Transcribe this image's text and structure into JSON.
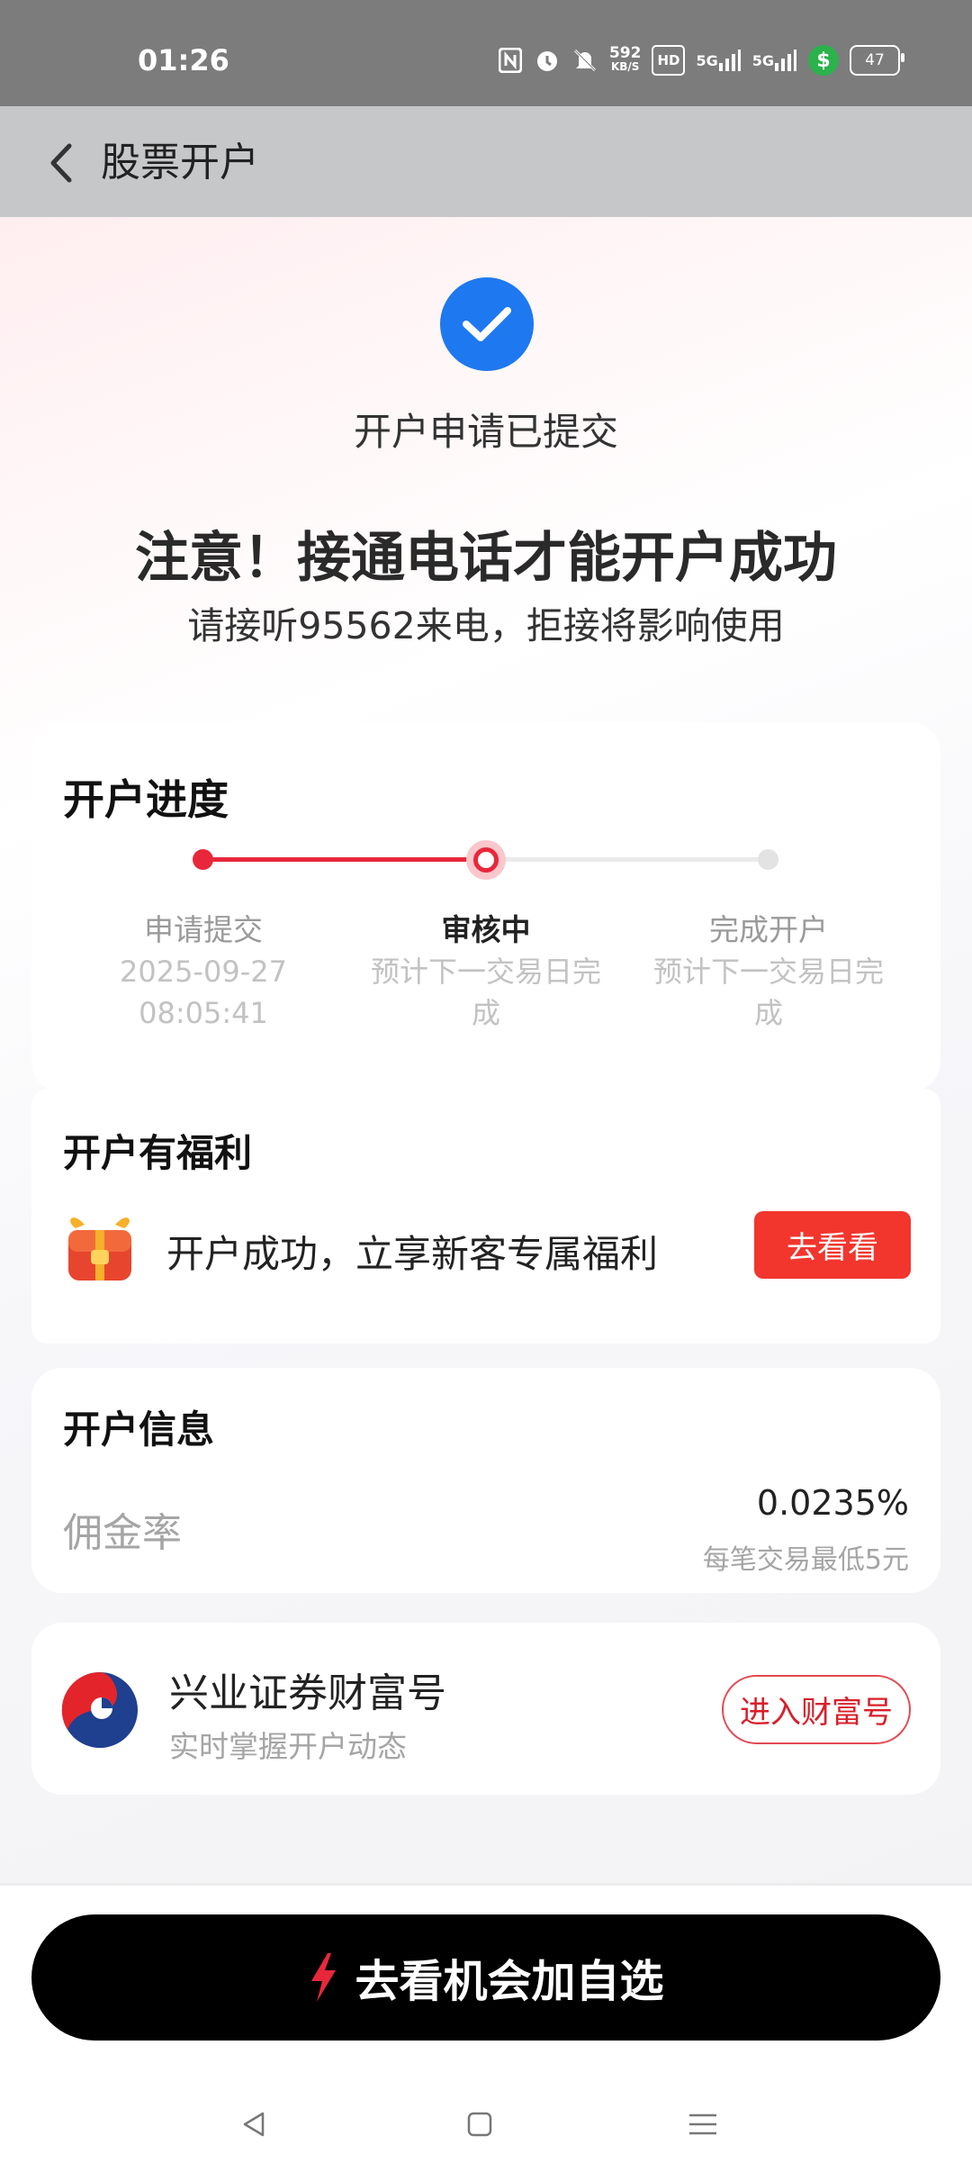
{
  "status_bar": {
    "time": "01:26",
    "icons": [
      "nfc-icon",
      "alarm-icon",
      "mute-icon",
      "network-speed",
      "hd-icon",
      "signal-5g-icon",
      "signal-5g-icon",
      "wallet-dollar-icon",
      "battery-icon"
    ],
    "network_speed_value": "592",
    "network_speed_unit": "KB/S",
    "hd_label": "HD",
    "signal_label": "5G",
    "battery_level": "47"
  },
  "header": {
    "title": "股票开户",
    "back_icon": "chevron-left-icon"
  },
  "submission": {
    "status_text": "开户申请已提交",
    "notice_title": "注意！接通电话才能开户成功",
    "notice_subtitle": "请接听95562来电，拒接将影响使用"
  },
  "progress": {
    "title": "开户进度",
    "steps": [
      {
        "label": "申请提交",
        "sub_line1": "2025-09-27",
        "sub_line2": "08:05:41",
        "state": "done"
      },
      {
        "label": "审核中",
        "sub_line1": "预计下一交易日完",
        "sub_line2": "成",
        "state": "active"
      },
      {
        "label": "完成开户",
        "sub_line1": "预计下一交易日完",
        "sub_line2": "成",
        "state": "pending"
      }
    ],
    "accent_color": "#e8283a"
  },
  "benefit": {
    "title": "开户有福利",
    "text": "开户成功，立享新客专属福利",
    "button_label": "去看看"
  },
  "account_info": {
    "title": "开户信息",
    "commission_label": "佣金率",
    "commission_value": "0.0235%",
    "commission_note": "每笔交易最低5元"
  },
  "wealth": {
    "name": "兴业证券财富号",
    "description": "实时掌握开户动态",
    "button_label": "进入财富号"
  },
  "cta": {
    "label": "去看机会加自选",
    "icon": "lightning-icon"
  },
  "system_nav": {
    "buttons": [
      "back-triangle-icon",
      "home-square-icon",
      "menu-lines-icon"
    ]
  }
}
